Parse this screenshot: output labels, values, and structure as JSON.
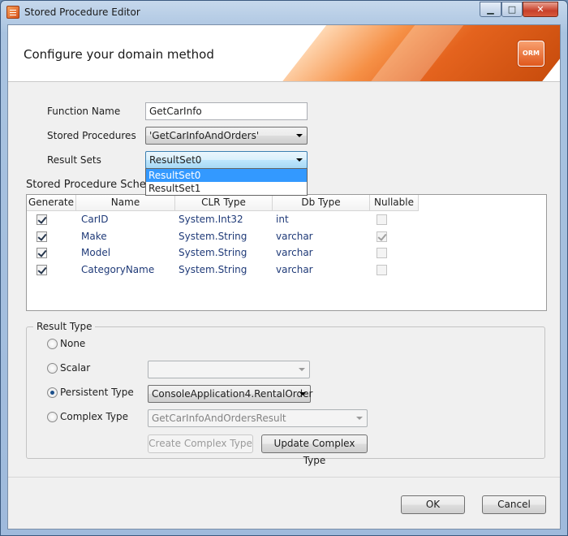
{
  "window": {
    "title": "Stored Procedure Editor",
    "close_glyph": "✕",
    "min_glyph": "▁",
    "max_glyph": "□"
  },
  "header": {
    "title": "Configure your domain method",
    "logo_text": "ORM"
  },
  "form": {
    "function_name_label": "Function Name",
    "function_name_value": "GetCarInfo",
    "stored_procedures_label": "Stored Procedures",
    "stored_procedures_value": "'GetCarInfoAndOrders'",
    "result_sets_label": "Result Sets",
    "result_sets_value": "ResultSet0",
    "result_sets_options": [
      "ResultSet0",
      "ResultSet1"
    ]
  },
  "schema": {
    "label": "Stored Procedure Schema",
    "columns": [
      "Generate",
      "Name",
      "CLR Type",
      "Db Type",
      "Nullable"
    ],
    "rows": [
      {
        "generate": true,
        "name": "CarID",
        "clr": "System.Int32",
        "db": "int",
        "nullable": false
      },
      {
        "generate": true,
        "name": "Make",
        "clr": "System.String",
        "db": "varchar",
        "nullable": true
      },
      {
        "generate": true,
        "name": "Model",
        "clr": "System.String",
        "db": "varchar",
        "nullable": false
      },
      {
        "generate": true,
        "name": "CategoryName",
        "clr": "System.String",
        "db": "varchar",
        "nullable": false
      }
    ]
  },
  "result_type": {
    "legend": "Result Type",
    "none_label": "None",
    "scalar_label": "Scalar",
    "scalar_value": "",
    "persistent_label": "Persistent Type",
    "persistent_value": "ConsoleApplication4.RentalOrder",
    "complex_label": "Complex Type",
    "complex_value": "GetCarInfoAndOrdersResult",
    "selected": "persistent",
    "create_button": "Create Complex Type",
    "update_button": "Update Complex Type"
  },
  "footer": {
    "ok": "OK",
    "cancel": "Cancel"
  }
}
